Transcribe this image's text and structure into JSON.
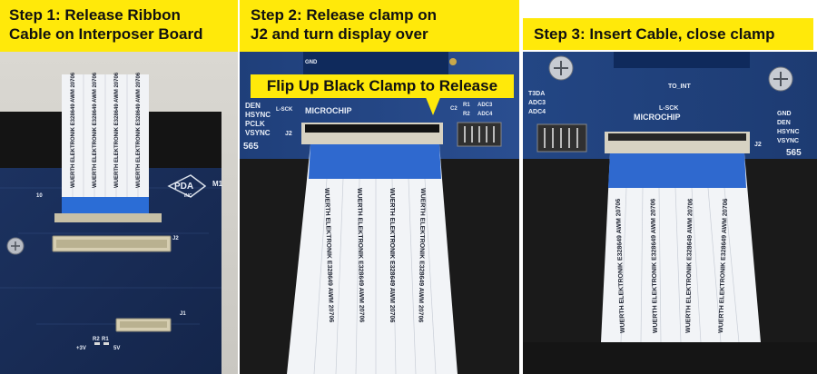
{
  "captions": {
    "step1_line1": "Step 1: Release Ribbon",
    "step1_line2": "Cable on Interposer Board",
    "step2_line1": "Step 2: Release clamp on",
    "step2_line2": "J2 and turn display over",
    "step3": "Step 3: Insert Cable, close clamp"
  },
  "callout": "Flip Up Black Clamp to Release",
  "board1": {
    "logo": "PDA",
    "logo_sub": "INC",
    "j2": "J2",
    "j1": "J1",
    "r1": "R1",
    "r2": "R2",
    "v3": "+3V",
    "v5": "5V",
    "num10": "10",
    "m1": "M1"
  },
  "board2": {
    "gnd": "GND",
    "labels_left": [
      "DEN",
      "HSYNC",
      "PCLK",
      "VSYNC"
    ],
    "j2": "J2",
    "num565": "565",
    "sck": "L-SCK",
    "microchip": "MICROCHIP",
    "adc": [
      "ADC4",
      "ADC3"
    ],
    "r1": "R1",
    "r2": "R2",
    "c2": "C2"
  },
  "board3": {
    "labels_left": [
      "T3DA",
      "ADC3",
      "ADC4"
    ],
    "sck": "L-SCK",
    "microchip": "MICROCHIP",
    "to_int": "TO_INT",
    "j2": "J2",
    "num565": "565",
    "labels_right": [
      "GND",
      "DEN",
      "HSYNC",
      "VSYNC"
    ]
  },
  "cable_text": "WUERTH ELEKTRONIK  E328649  AWM 20706"
}
